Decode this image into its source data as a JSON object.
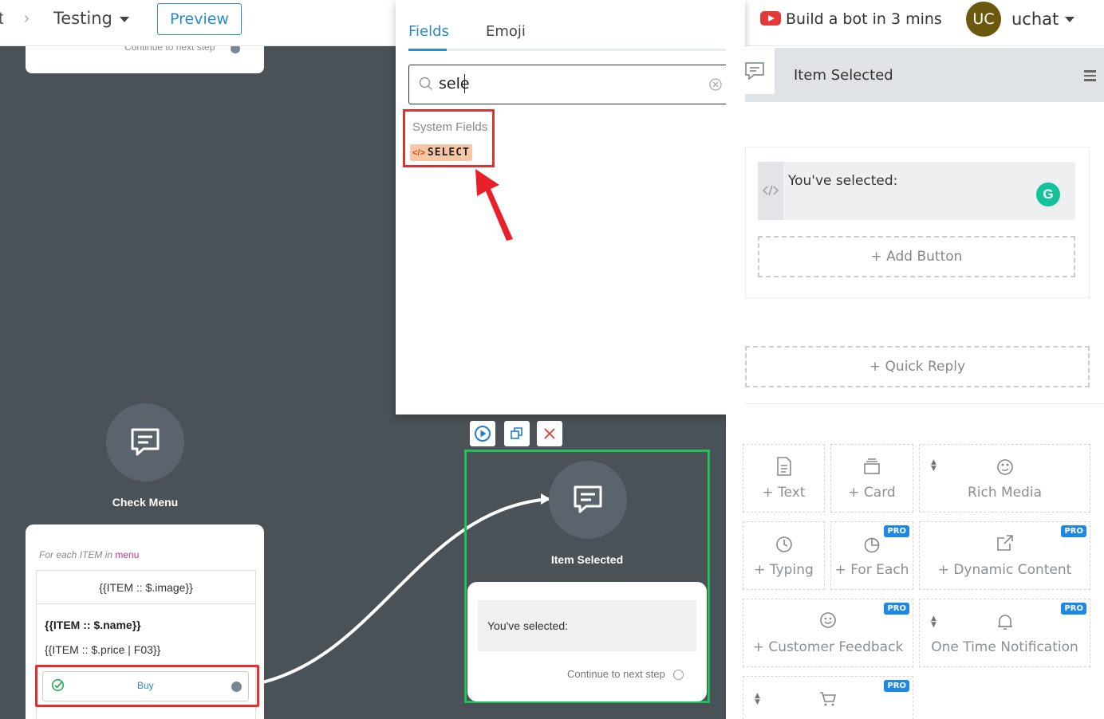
{
  "topbar": {
    "breadcrumb_prev": "t",
    "breadcrumb_sep": "›",
    "breadcrumb_current": "Testing",
    "preview_label": "Preview",
    "build_link": "Build a bot in 3 mins",
    "avatar_initials": "UC",
    "username": "uchat"
  },
  "canvas": {
    "top_card_continue": "Continue to next step",
    "check_menu": {
      "title": "Check Menu",
      "foreach_prefix": "For each ITEM in",
      "foreach_var": "menu",
      "image_field": "{{ITEM :: $.image}}",
      "name_field": "{{ITEM :: $.name}}",
      "price_field": "{{ITEM :: $.price | F03}}",
      "buy_label": "Buy"
    },
    "item_selected": {
      "title": "Item Selected",
      "message": "You've selected:",
      "continue_label": "Continue to next step"
    }
  },
  "picker": {
    "tabs": [
      {
        "label": "Fields",
        "active": true
      },
      {
        "label": "Emoji",
        "active": false
      }
    ],
    "search_value": "sele",
    "group_label": "System Fields",
    "result_code_icon": "</>",
    "result_label": "SELECT"
  },
  "panel": {
    "title": "Item Selected",
    "message_text": "You've selected:",
    "add_button": "+ Add Button",
    "quick_reply": "+ Quick Reply",
    "pro_badge": "PRO",
    "tiles": {
      "text": "+ Text",
      "card": "+ Card",
      "rich_media": "Rich Media",
      "typing": "+ Typing",
      "for_each": "+ For Each",
      "dynamic_content": "+ Dynamic Content",
      "customer_feedback": "+ Customer Feedback",
      "one_time_notification": "One Time Notification"
    }
  },
  "colors": {
    "accent": "#2a89c9",
    "highlight": "#e03030",
    "selected_outline": "#20c05a",
    "pro": "#1e88e5"
  }
}
